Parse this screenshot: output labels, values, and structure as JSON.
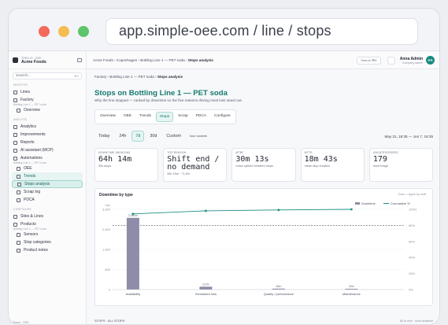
{
  "browser": {
    "url": "app.simple-oee.com / line / stops"
  },
  "sidebar": {
    "brand_sub": "TRELLIS · OEE",
    "brand_name": "Acme Foods",
    "search_placeholder": "Search...",
    "search_kbd": "⌘K",
    "section_monitor": "MONITOR",
    "lines": "Lines",
    "factory": "Factory",
    "factory_hint": "Bottling Line 1 — PET soda",
    "overview": "Overview",
    "section_analyse": "ANALYSE",
    "analytics": "Analytics",
    "improvements": "Improvements",
    "reports": "Reports",
    "ai_assistant": "AI assistant (MCP)",
    "automations": "Automations",
    "automations_hint": "Bottling Line 1 — PET soda",
    "oee": "OEE",
    "trends": "Trends",
    "stops_analysis": "Stops analysis",
    "scrap_log": "Scrap log",
    "pdca": "PDCA",
    "section_configure": "CONFIGURE",
    "sites_lines": "Sites & Lines",
    "products": "Products",
    "products_hint": "Bottling Line 1 — PET soda",
    "sensors": "Sensors",
    "stop_categories": "Stop categories",
    "product_notes": "Product notes",
    "footer": "Plants · OEE"
  },
  "topbar": {
    "crumb_root": "Acme Foods",
    "crumb_site": "Copenhagen",
    "crumb_line": "Bottling Line 1 — PET soda",
    "crumb_page": "Stops analysis",
    "search_label": "Search",
    "search_kbd": "⌘K",
    "user_name": "Anna Admin",
    "user_role": "Company admin",
    "avatar": "AA"
  },
  "page": {
    "crumb_factory": "Factory",
    "crumb_line": "Bottling Line 1 — PET soda",
    "crumb_page": "Stops analysis",
    "title": "Stops on Bottling Line 1 — PET soda",
    "subtitle": "Why the line stopped — ranked by downtime so the five reasons driving most loss stand out.",
    "tabs": [
      "Overview",
      "OEE",
      "Trends",
      "Stops",
      "Scrap",
      "PDCA",
      "Configure"
    ],
    "active_tab": "Stops",
    "ranges": [
      "Today",
      "24h",
      "7d",
      "30d",
      "Custom"
    ],
    "active_range": "7d",
    "range_hint": "hour buckets",
    "range_dates": "May 31, 18:35 — Jun 7, 18:35"
  },
  "kpis": [
    {
      "label": "DOWNTIME (WINDOW)",
      "value": "64h 14m",
      "sub": "35s stops"
    },
    {
      "label": "TOP REASON",
      "value": "Shift end / no demand",
      "sub": "46h 15m · 71.6%"
    },
    {
      "label": "MTBF",
      "value": "30m 13s",
      "sub": "mean uptime between stops"
    },
    {
      "label": "MTTR",
      "value": "18m 43s",
      "sub": "mean stop duration"
    },
    {
      "label": "UNCATEGORISED",
      "value": "179",
      "sub": "need triage"
    }
  ],
  "chart_data": {
    "type": "bar",
    "title": "Downtime by type",
    "categories": [
      "Availability",
      "Scheduled loss",
      "Quality / performance",
      "Maintenance"
    ],
    "series": [
      {
        "name": "Downtime",
        "values": [
          2860,
          115,
          38,
          34
        ],
        "unit": "min"
      },
      {
        "name": "Cumulative %",
        "values": [
          94.3,
          98.1,
          99.2,
          100
        ],
        "unit": "%"
      }
    ],
    "bar_labels": [
      "2,860m",
      "115m",
      "38m",
      "34m"
    ],
    "ylabel_left": "min",
    "yticks_left": [
      0,
      800,
      1600,
      2400,
      3200
    ],
    "yticks_right": [
      "0%",
      "20%",
      "40%",
      "60%",
      "80%",
      "100%"
    ],
    "ylim_left": [
      0,
      3200
    ],
    "ylim_right": [
      0,
      100
    ],
    "reference_line_pct": 80,
    "colors": {
      "bar": "#8e8ca8",
      "line": "#1f8f84",
      "ref": "#4a5060"
    },
    "legend_position": "top-right",
    "right_control": "Color = types by shift"
  },
  "footer": {
    "left": "STOPS · ALL STOPS",
    "right": "85 of next · none available"
  },
  "colors": {
    "accent": "#167a70",
    "accent_bg": "#e6f4f2"
  }
}
